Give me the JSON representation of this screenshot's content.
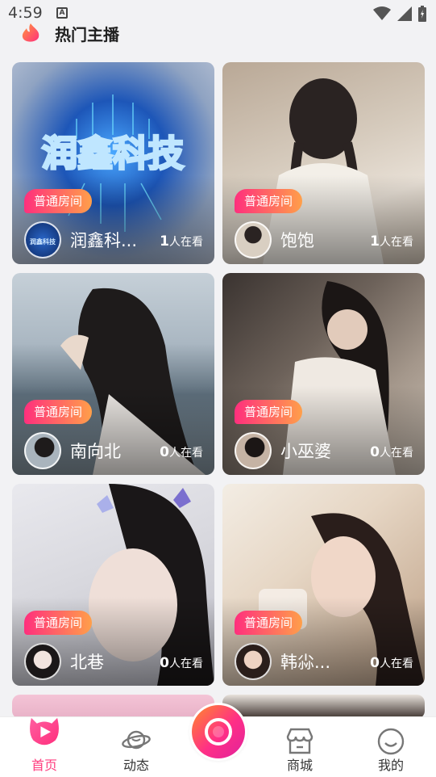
{
  "status": {
    "time": "4:59",
    "a_icon": "A"
  },
  "header": {
    "title": "热门主播",
    "icon": "flame-icon"
  },
  "cards": [
    {
      "badge": "普通房间",
      "name": "润鑫科...",
      "count": "1",
      "suffix": "人在看",
      "bg": "tech-logo-image",
      "cover_text": "润鑫科技",
      "avatar_text": "润鑫科技"
    },
    {
      "badge": "普通房间",
      "name": "饱饱",
      "count": "1",
      "suffix": "人在看",
      "bg": "girl-braids-image"
    },
    {
      "badge": "普通房间",
      "name": "南向北",
      "count": "0",
      "suffix": "人在看",
      "bg": "girl-seaside-image"
    },
    {
      "badge": "普通房间",
      "name": "小巫婆",
      "count": "0",
      "suffix": "人在看",
      "bg": "girl-room-image"
    },
    {
      "badge": "普通房间",
      "name": "北巷",
      "count": "0",
      "suffix": "人在看",
      "bg": "girl-butterfly-image"
    },
    {
      "badge": "普通房间",
      "name": "韩尛...",
      "count": "0",
      "suffix": "人在看",
      "bg": "girl-cup-image"
    }
  ],
  "tabs": [
    {
      "label": "首页",
      "icon": "play-home-icon",
      "active": true
    },
    {
      "label": "动态",
      "icon": "planet-icon",
      "active": false
    },
    {
      "label": "商城",
      "icon": "shop-icon",
      "active": false
    },
    {
      "label": "我的",
      "icon": "smile-icon",
      "active": false
    }
  ],
  "colors": {
    "accent": "#ff3d7f",
    "badge_start": "#ff2f7d",
    "badge_end": "#ff9f4a"
  }
}
